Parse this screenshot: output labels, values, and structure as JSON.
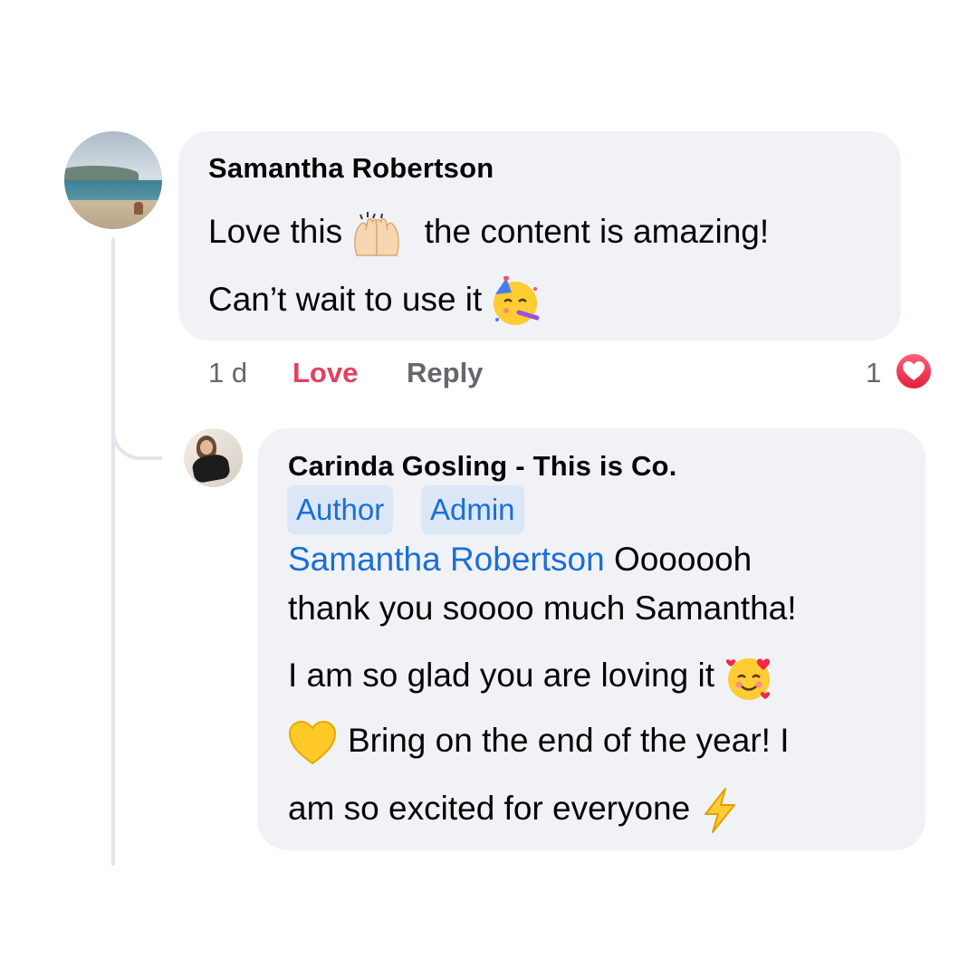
{
  "comment": {
    "author": "Samantha Robertson",
    "line1_before": "Love this",
    "line1_after": "the content is amazing!",
    "line2": "Can’t wait to use it",
    "time": "1 d",
    "love_label": "Love",
    "reply_label": "Reply",
    "reaction_count": "1"
  },
  "reply": {
    "author": "Carinda Gosling - This is Co.",
    "badges": [
      "Author",
      "Admin"
    ],
    "mention": "Samantha Robertson",
    "line1_rest": "Ooooooh",
    "line2": "thank you soooo much Samantha!",
    "line3": "I am so glad you are loving it",
    "line4": "Bring on the end of the year! I",
    "line5": "am so excited for everyone"
  },
  "colors": {
    "bubble": "#f0f2f5",
    "love": "#e4405f",
    "mention": "#1a6ed8",
    "badge_bg": "#dbe7f7",
    "meta": "#65676b"
  },
  "icons": [
    "raising-hands-icon",
    "partying-face-icon",
    "smiling-face-with-hearts-icon",
    "yellow-heart-icon",
    "high-voltage-icon",
    "love-reaction-icon"
  ]
}
